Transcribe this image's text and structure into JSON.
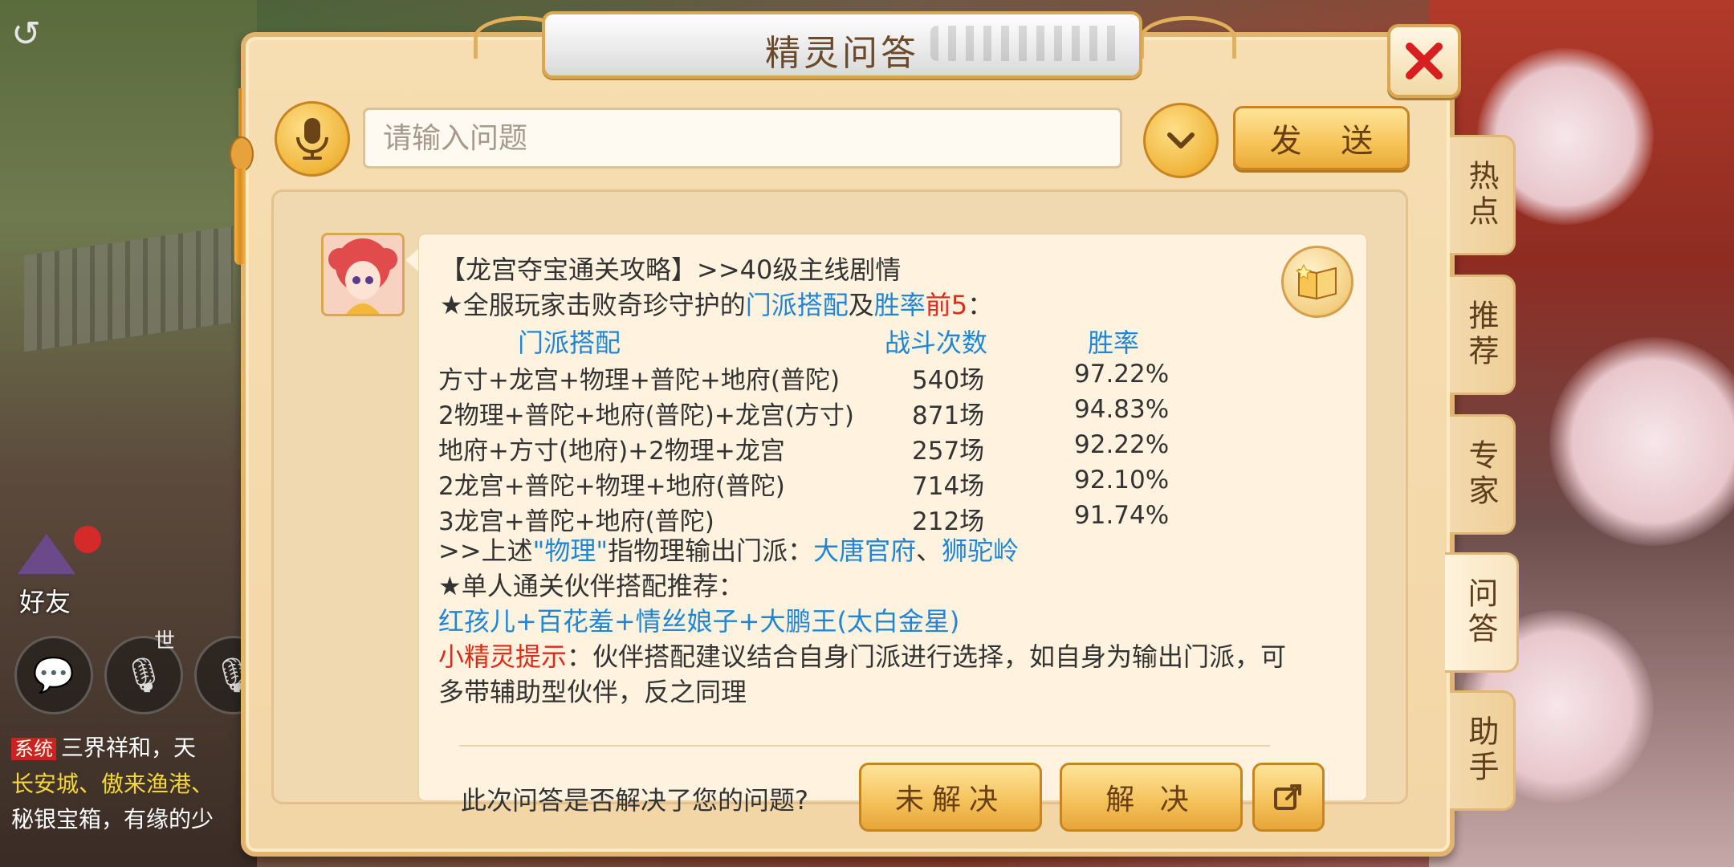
{
  "background": {
    "friend_label": "好友",
    "world_label": "世",
    "chat": {
      "system_tag": "系统",
      "line1": "三界祥和，天",
      "line2": "长安城、傲来渔港、",
      "line3": "秘银宝箱，有缘的少"
    }
  },
  "dialog": {
    "title": "精灵问答",
    "search": {
      "placeholder": "请输入问题",
      "value": ""
    },
    "send_label": "发 送",
    "side_tabs": [
      "热点",
      "推荐",
      "专家",
      "问答",
      "助手"
    ],
    "active_tab": "问答",
    "answer": {
      "heading": "【龙宫夺宝通关攻略】>>40级主线剧情",
      "intro_prefix": "★全服玩家击败奇珍守护的",
      "intro_term1": "门派搭配",
      "intro_and": "及",
      "intro_term2": "胜率",
      "intro_top": "前5",
      "intro_colon": "：",
      "table": {
        "headers": [
          "门派搭配",
          "战斗次数",
          "胜率"
        ],
        "rows": [
          [
            "方寸+龙宫+物理+普陀+地府(普陀)",
            "540场",
            "97.22%"
          ],
          [
            "2物理+普陀+地府(普陀)+龙宫(方寸)",
            "871场",
            "94.83%"
          ],
          [
            "地府+方寸(地府)+2物理+龙宫",
            "257场",
            "92.22%"
          ],
          [
            "2龙宫+普陀+物理+地府(普陀)",
            "714场",
            "92.10%"
          ],
          [
            "3龙宫+普陀+地府(普陀)",
            "212场",
            "91.74%"
          ]
        ]
      },
      "note_prefix": ">>上述",
      "note_term": "\"物理\"",
      "note_middle": "指物理输出门派：",
      "note_school1": "大唐官府",
      "note_sep": "、",
      "note_school2": "狮驼岭",
      "partner_heading": "★单人通关伙伴搭配推荐：",
      "partner_combo": "红孩儿+百花羞+情丝娘子+大鹏王(太白金星)",
      "tip_label": "小精灵提示",
      "tip_text1": "：伙伴搭配建议结合自身门派进行选择，如自身为输出门派，可",
      "tip_text2": "多带辅助型伙伴，反之同理"
    },
    "feedback": {
      "question": "此次问答是否解决了您的问题?",
      "unsolved": "未解决",
      "solved": "解 决"
    }
  },
  "colors": {
    "accent_blue": "#1f86d6",
    "accent_red": "#e02a1a",
    "gold": "#f0b53a"
  }
}
